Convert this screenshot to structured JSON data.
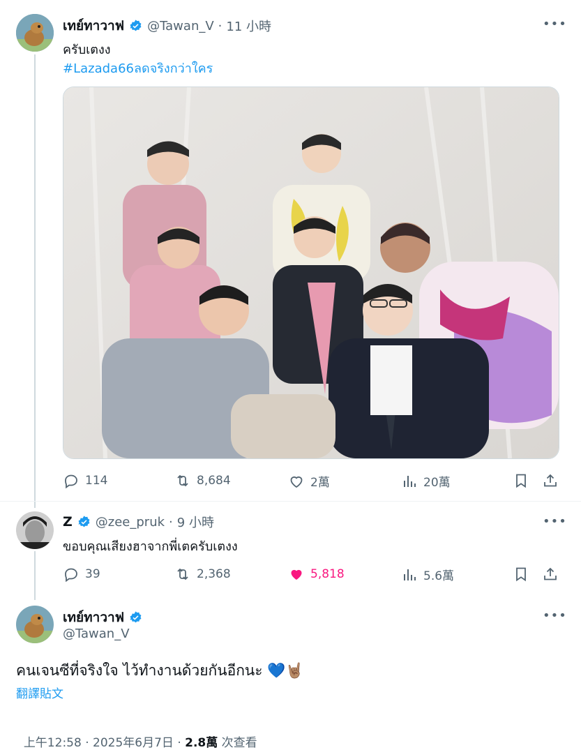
{
  "tweet1": {
    "display_name": "เทย์ทาวาฟ",
    "handle": "@Tawan_V",
    "separator": "·",
    "time": "11 小時",
    "text": "ครับเตงง",
    "hashtag": "#Lazada66ลดจริงกว่าใคร",
    "stats": {
      "replies": "114",
      "retweets": "8,684",
      "likes": "2萬",
      "views": "20萬"
    }
  },
  "tweet2": {
    "display_name": "Z",
    "handle": "@zee_pruk",
    "separator": "·",
    "time": "9 小時",
    "text": "ขอบคุณเสียงฮาจากพี่เตครับเตงง",
    "stats": {
      "replies": "39",
      "retweets": "2,368",
      "likes": "5,818",
      "views": "5.6萬"
    }
  },
  "tweet3": {
    "display_name": "เทย์ทาวาฟ",
    "handle": "@Tawan_V",
    "text": "คนเจนซีที่จริงใจ ไว้ทำงานด้วยกันอีกนะ 💙🤘🏽",
    "translate": "翻譯貼文",
    "timestamp": "上午12:58 · 2025年6月7日 · ",
    "views_count": "2.8萬",
    "views_label": " 次查看"
  },
  "more_label": "•••",
  "colors": {
    "accent": "#1d9bf0",
    "like_active": "#f91880",
    "secondary": "#536471"
  },
  "icons": [
    "reply-icon",
    "retweet-icon",
    "like-icon",
    "views-icon",
    "bookmark-icon",
    "share-icon",
    "verified-icon",
    "more-icon"
  ]
}
